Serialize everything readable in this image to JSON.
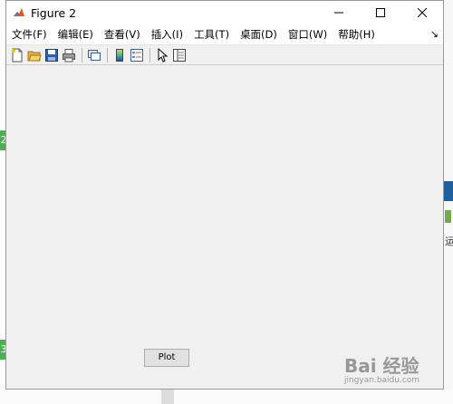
{
  "window": {
    "title": "Figure 2",
    "controls": [
      "minimize",
      "maximize",
      "close"
    ]
  },
  "menubar": {
    "items": [
      {
        "label": "文件(F)"
      },
      {
        "label": "编辑(E)"
      },
      {
        "label": "查看(V)"
      },
      {
        "label": "插入(I)"
      },
      {
        "label": "工具(T)"
      },
      {
        "label": "桌面(D)"
      },
      {
        "label": "窗口(W)"
      },
      {
        "label": "帮助(H)"
      }
    ],
    "overflow_arrow": "↘"
  },
  "toolbar": {
    "icons": [
      "new-figure-icon",
      "open-file-icon",
      "save-icon",
      "print-icon",
      "link-plot-icon",
      "colorbar-icon",
      "legend-icon",
      "edit-plot-arrow-icon",
      "property-inspector-icon"
    ]
  },
  "canvas": {
    "plot_button_label": "Plot"
  },
  "background": {
    "left_badges": [
      "2",
      "3"
    ],
    "right_text": "运",
    "watermark": "Bai 经验",
    "watermark_sub": "jingyan.baidu.com"
  }
}
